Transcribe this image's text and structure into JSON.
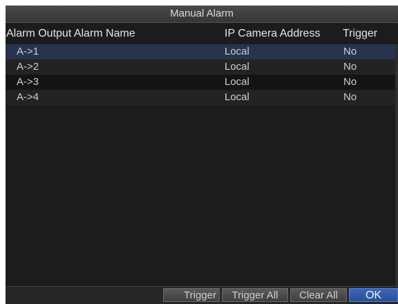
{
  "window": {
    "title": "Manual Alarm"
  },
  "table": {
    "headers": {
      "alarm_output": "Alarm Output",
      "alarm_name": "Alarm Name",
      "ip_camera_address": "IP Camera Address",
      "trigger": "Trigger"
    },
    "rows": [
      {
        "name": "A->1",
        "address": "Local",
        "trigger": "No"
      },
      {
        "name": "A->2",
        "address": "Local",
        "trigger": "No"
      },
      {
        "name": "A->3",
        "address": "Local",
        "trigger": "No"
      },
      {
        "name": "A->4",
        "address": "Local",
        "trigger": "No"
      }
    ],
    "selected_row": 0
  },
  "buttons": {
    "trigger": "Trigger",
    "trigger_all": "Trigger All",
    "clear_all": "Clear All",
    "ok": "OK"
  },
  "colors": {
    "selected_row": "#26344d",
    "ok_button": "#2f58a8",
    "background": "#202020"
  }
}
